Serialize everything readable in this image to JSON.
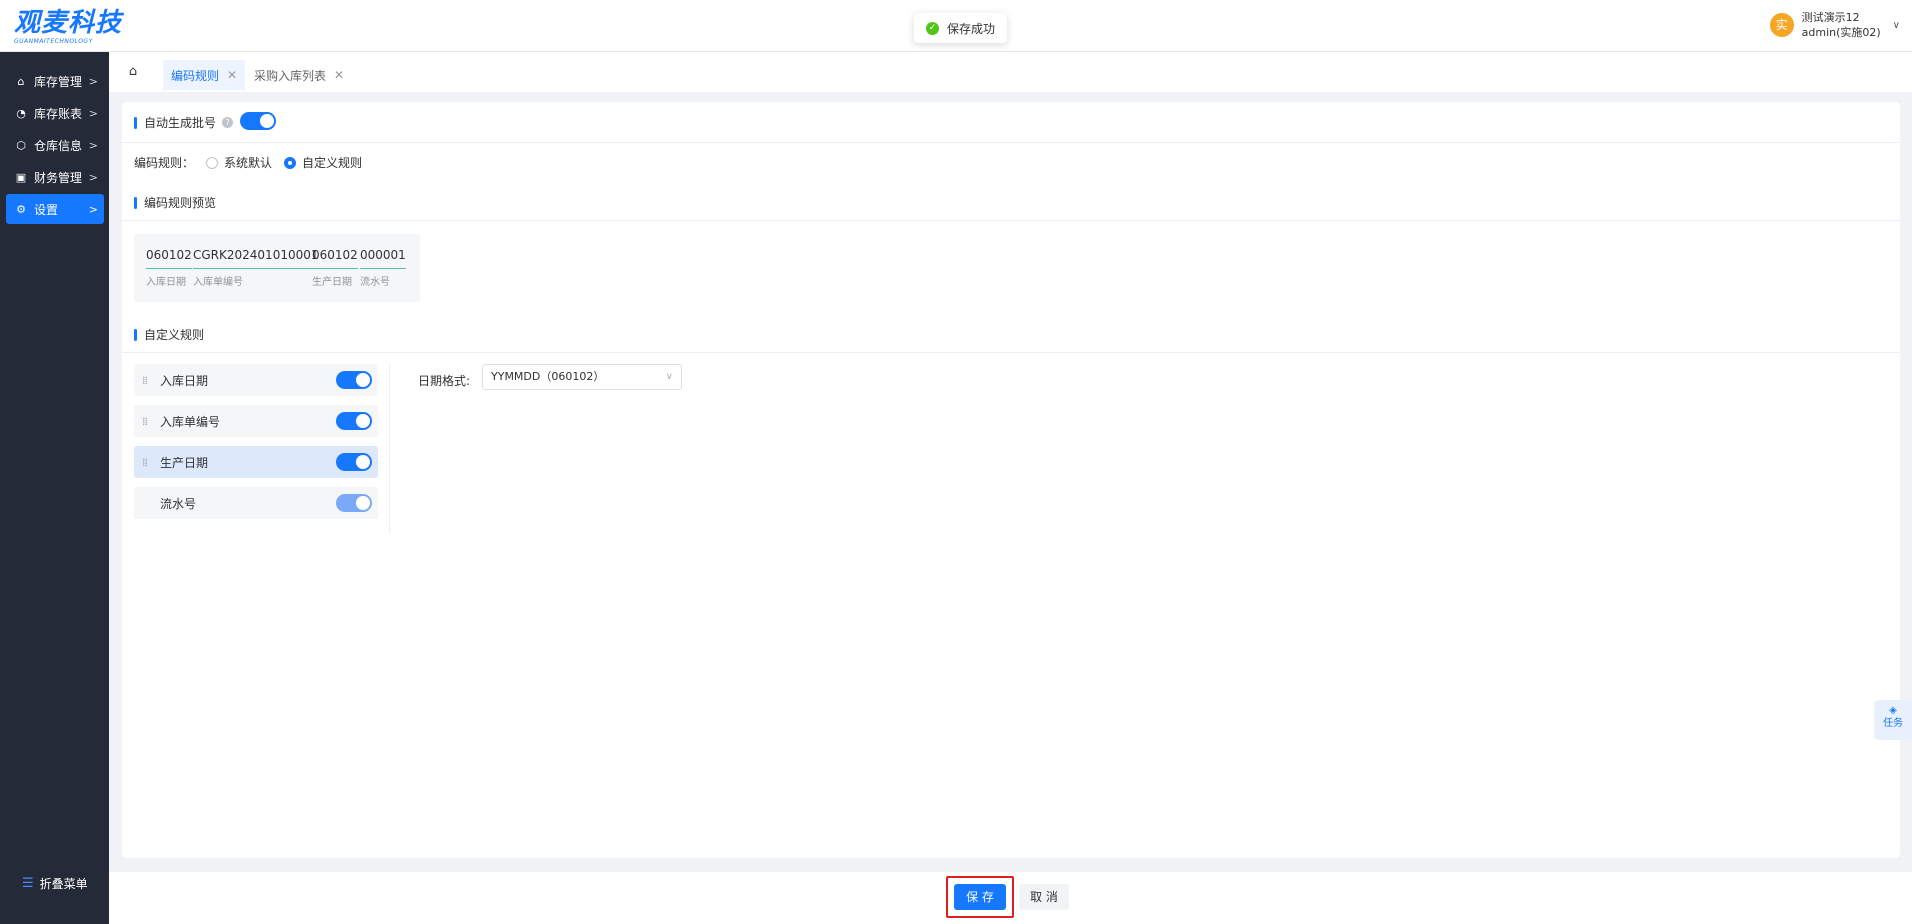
{
  "header": {
    "logo_text": "观麦科技",
    "logo_subtext": "GUANMAITECHNOLOGY",
    "toast_message": "保存成功",
    "user_avatar_char": "实",
    "user_name": "测试演示12",
    "user_account": "admin(实施02)"
  },
  "sidebar": {
    "items": [
      {
        "label": "库存管理",
        "icon": "home-icon"
      },
      {
        "label": "库存账表",
        "icon": "ledger-icon"
      },
      {
        "label": "仓库信息",
        "icon": "box-icon"
      },
      {
        "label": "财务管理",
        "icon": "finance-icon"
      },
      {
        "label": "设置",
        "icon": "gear-icon",
        "active": true
      }
    ],
    "collapse_label": "折叠菜单"
  },
  "tabs": [
    {
      "label": "编码规则",
      "active": true
    },
    {
      "label": "采购入库列表",
      "active": false
    }
  ],
  "main": {
    "auto_batch_label": "自动生成批号",
    "auto_batch_enabled": true,
    "rule_label": "编码规则：",
    "radio_options": [
      {
        "label": "系统默认",
        "checked": false
      },
      {
        "label": "自定义规则",
        "checked": true
      }
    ],
    "preview_title": "编码规则预览",
    "preview_segments": [
      {
        "value": "060102",
        "label": "入库日期"
      },
      {
        "value": "CGRK202401010001",
        "label": "入库单编号"
      },
      {
        "value": "060102",
        "label": "生产日期"
      },
      {
        "value": "000001",
        "label": "流水号"
      }
    ],
    "custom_title": "自定义规则",
    "rule_items": [
      {
        "label": "入库日期",
        "enabled": true,
        "selected": false,
        "draggable": true
      },
      {
        "label": "入库单编号",
        "enabled": true,
        "selected": false,
        "draggable": true
      },
      {
        "label": "生产日期",
        "enabled": true,
        "selected": true,
        "draggable": true
      },
      {
        "label": "流水号",
        "enabled": true,
        "selected": false,
        "draggable": false
      }
    ],
    "date_format_label": "日期格式:",
    "date_format_value": "YYMMDD（060102）"
  },
  "task_label": "任务",
  "footer": {
    "save_label": "保 存",
    "cancel_label": "取 消"
  },
  "colors": {
    "primary": "#1677ff",
    "sidebar_bg": "#252a38",
    "success": "#52c41a",
    "highlight_frame": "#e02020"
  }
}
